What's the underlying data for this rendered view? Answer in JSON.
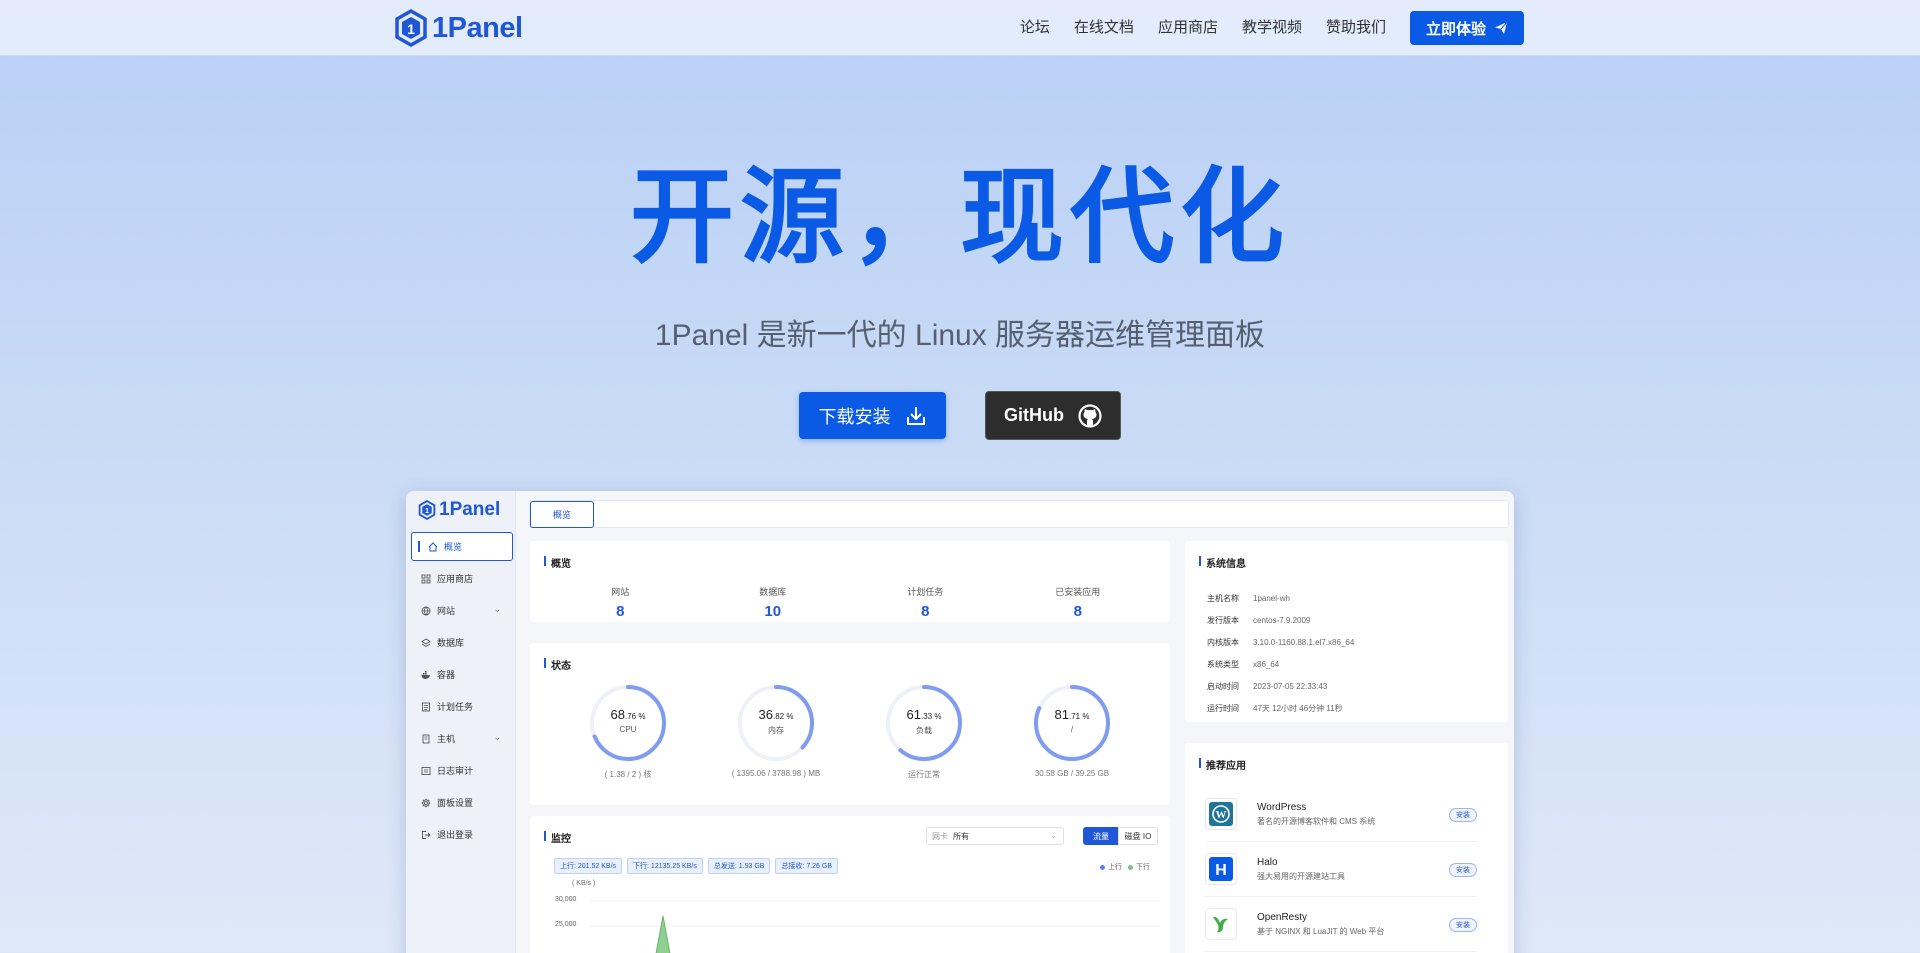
{
  "brand": {
    "name": "1Panel"
  },
  "nav": {
    "links": [
      "论坛",
      "在线文档",
      "应用商店",
      "教学视频",
      "赞助我们"
    ],
    "cta_label": "立即体验"
  },
  "hero": {
    "title": "开源，现代化",
    "subtitle": "1Panel 是新一代的 Linux 服务器运维管理面板",
    "download_label": "下载安装",
    "github_label": "GitHub"
  },
  "dashboard": {
    "logo": "1Panel",
    "sidebar": [
      {
        "label": "概览",
        "icon": "home-icon",
        "active": true
      },
      {
        "label": "应用商店",
        "icon": "grid-icon"
      },
      {
        "label": "网站",
        "icon": "globe-icon",
        "expand": true
      },
      {
        "label": "数据库",
        "icon": "layers-icon"
      },
      {
        "label": "容器",
        "icon": "docker-icon"
      },
      {
        "label": "计划任务",
        "icon": "list-icon"
      },
      {
        "label": "主机",
        "icon": "server-icon",
        "expand": true
      },
      {
        "label": "日志审计",
        "icon": "log-icon"
      },
      {
        "label": "面板设置",
        "icon": "gear-icon"
      },
      {
        "label": "退出登录",
        "icon": "logout-icon"
      }
    ],
    "tab": "概览",
    "overview": {
      "title": "概览",
      "stats": [
        {
          "label": "网站",
          "value": "8"
        },
        {
          "label": "数据库",
          "value": "10"
        },
        {
          "label": "计划任务",
          "value": "8"
        },
        {
          "label": "已安装应用",
          "value": "8"
        }
      ]
    },
    "status": {
      "title": "状态",
      "gauges": [
        {
          "int": "68",
          "dec": ".76",
          "unit": " %",
          "label": "CPU",
          "sub": "( 1.38 / 2 ) 核",
          "percent": 68.76
        },
        {
          "int": "36",
          "dec": ".82",
          "unit": " %",
          "label": "内存",
          "sub": "( 1395.06 / 3788.98 ) MB",
          "percent": 36.82
        },
        {
          "int": "61",
          "dec": ".33",
          "unit": " %",
          "label": "负载",
          "sub": "运行正常",
          "percent": 61.33
        },
        {
          "int": "81",
          "dec": ".71",
          "unit": " %",
          "label": "/",
          "sub": "30.58 GB / 39.25 GB",
          "percent": 81.71
        }
      ]
    },
    "monitor": {
      "title": "监控",
      "select_placeholder": "网卡",
      "select_value": "所有",
      "seg_traffic": "流量",
      "seg_disk": "磁盘 IO",
      "chips": [
        "上行: 201.52 KB/s",
        "下行: 12135.25 KB/s",
        "总发送: 1.93 GB",
        "总接收: 7.26 GB"
      ],
      "legend_up": "上行",
      "legend_down": "下行",
      "unit": "( KB/s )",
      "ticks": [
        "30,000",
        "25,000"
      ],
      "colors": {
        "up": "#5b7ef0",
        "down": "#7ec47e"
      }
    },
    "system": {
      "title": "系统信息",
      "rows": [
        {
          "k": "主机名称",
          "v": "1panel-wh"
        },
        {
          "k": "发行版本",
          "v": "centos-7.9.2009"
        },
        {
          "k": "内核版本",
          "v": "3.10.0-1160.88.1.el7.x86_64"
        },
        {
          "k": "系统类型",
          "v": "x86_64"
        },
        {
          "k": "启动时间",
          "v": "2023-07-05 22:33:43"
        },
        {
          "k": "运行时间",
          "v": "47天 12小时 46分钟 11秒"
        }
      ]
    },
    "recommend": {
      "title": "推荐应用",
      "install_label": "安装",
      "apps": [
        {
          "name": "WordPress",
          "desc": "著名的开源博客软件和 CMS 系统",
          "icon": "wordpress-icon"
        },
        {
          "name": "Halo",
          "desc": "强大易用的开源建站工具",
          "icon": "halo-icon"
        },
        {
          "name": "OpenResty",
          "desc": "基于 NGINX 和 LuaJIT 的 Web 平台",
          "icon": "openresty-icon"
        }
      ]
    }
  },
  "colors": {
    "primary": "#0a5ae6",
    "brand_text": "#1f57d6",
    "github_bg": "#2d2d2d"
  }
}
